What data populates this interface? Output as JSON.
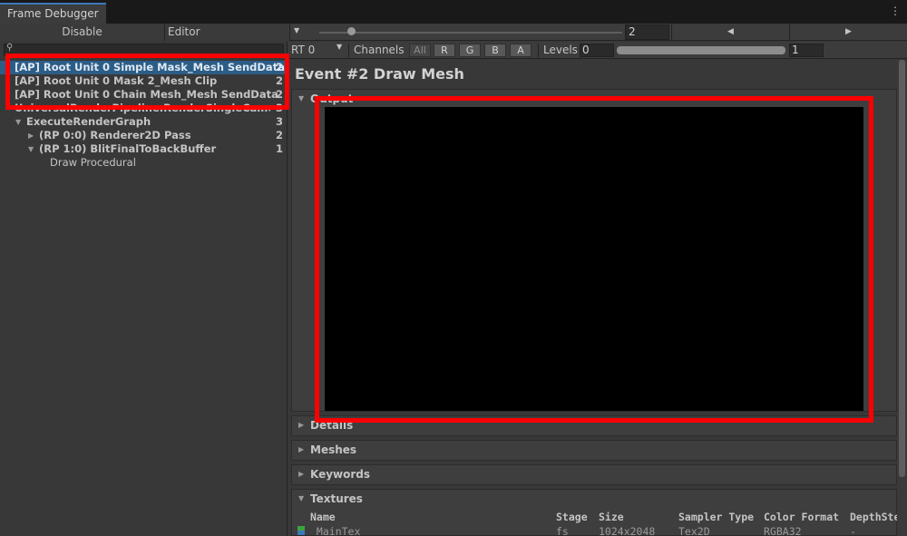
{
  "window": {
    "tab_title": "Frame Debugger",
    "menu_icon": "kebab-menu-icon"
  },
  "toolbar": {
    "disable_label": "Disable",
    "editor_label": "Editor",
    "event_index": "2",
    "slider_value": 2,
    "prev_icon": "step-back-icon",
    "next_icon": "step-forward-icon"
  },
  "tree": {
    "search_value": "",
    "rows": [
      {
        "label": "[AP] Root Unit 0 Simple Mask_Mesh SendData",
        "count": "2",
        "selected": true
      },
      {
        "label": "[AP] Root Unit 0 Mask 2_Mesh Clip",
        "count": "2"
      },
      {
        "label": "[AP] Root Unit 0 Chain Mesh_Mesh SendData",
        "count": "2"
      },
      {
        "label": "UniversalRenderPipeline.RenderSingleCameraInternal",
        "count": "3"
      },
      {
        "label": "ExecuteRenderGraph",
        "count": "3"
      },
      {
        "label": "(RP 0:0) Renderer2D Pass",
        "count": "2"
      },
      {
        "label": "(RP 1:0) BlitFinalToBackBuffer",
        "count": "1"
      },
      {
        "label": "Draw Procedural",
        "count": ""
      }
    ]
  },
  "render_target": {
    "rt_label": "RT 0",
    "channels_label": "Channels",
    "channels": [
      "All",
      "R",
      "G",
      "B",
      "A"
    ],
    "levels_label": "Levels",
    "levels_min": "0",
    "levels_max": "1"
  },
  "event": {
    "title": "Event #2 Draw Mesh"
  },
  "sections": {
    "output": "Output",
    "details": "Details",
    "meshes": "Meshes",
    "keywords": "Keywords",
    "textures": "Textures"
  },
  "textures_table": {
    "headers": [
      "Name",
      "Stage",
      "Size",
      "Sampler Type",
      "Color Format",
      "DepthSte"
    ],
    "rows": [
      {
        "name": "_MainTex",
        "stage": "fs",
        "size": "1024x2048",
        "sampler": "Tex2D",
        "format": "RGBA32",
        "depth": "-"
      }
    ]
  },
  "colors": {
    "highlight": "#ff0000",
    "selection": "#2c5d87",
    "accent": "#3a79bb"
  }
}
